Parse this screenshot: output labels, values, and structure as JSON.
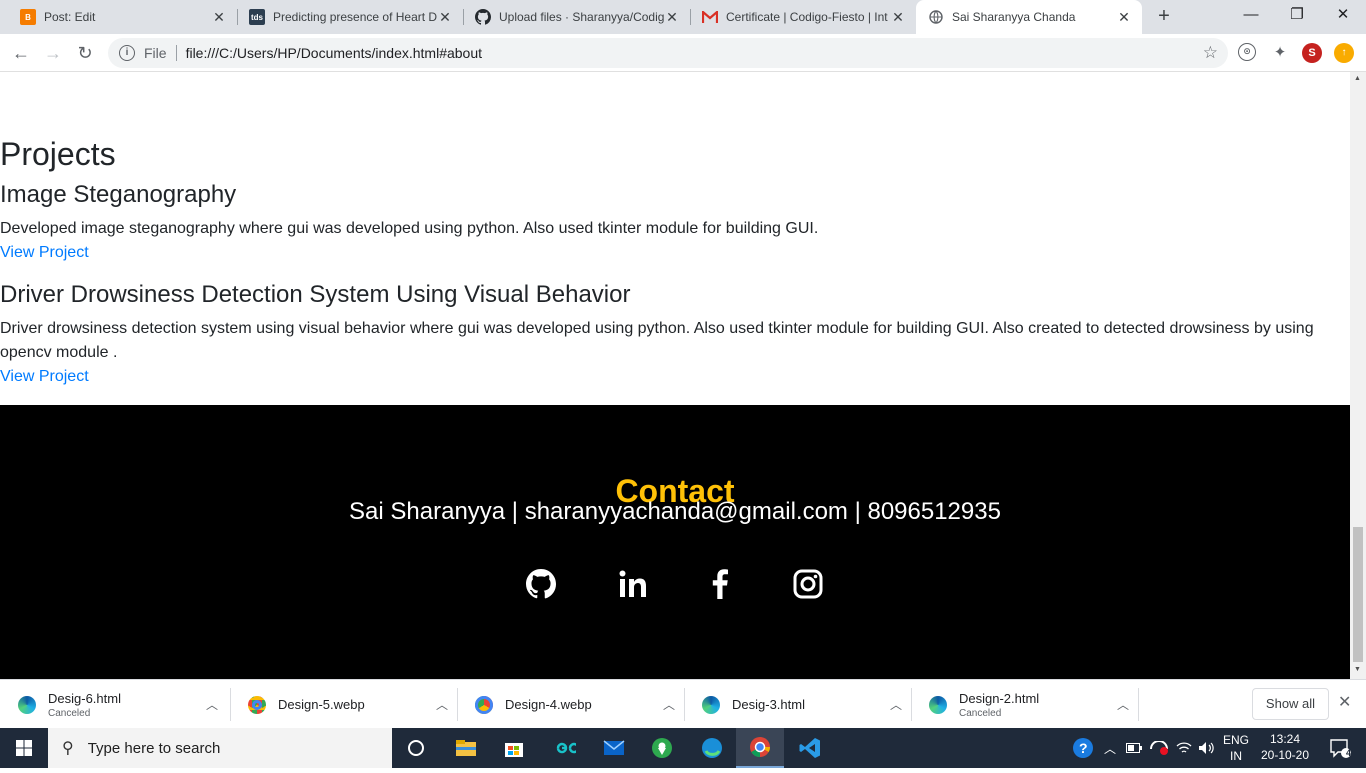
{
  "browser": {
    "tabs": [
      {
        "title": "Post: Edit",
        "favicon": "blogger-icon",
        "color": "#f57c00"
      },
      {
        "title": "Predicting presence of Heart D",
        "favicon": "tds-icon",
        "color": "#2c3e50",
        "favicon_text": "tds"
      },
      {
        "title": "Upload files · Sharanyya/Codig",
        "favicon": "github-icon",
        "color": "#24292e"
      },
      {
        "title": "Certificate | Codigo-Fiesto | Int",
        "favicon": "gmail-icon",
        "color": "#d93025"
      },
      {
        "title": "Sai Sharanyya Chanda",
        "favicon": "globe-icon",
        "color": "#5f6368"
      }
    ],
    "address": {
      "scheme_label": "File",
      "url": "file:///C:/Users/HP/Documents/index.html#about"
    },
    "profile_initial": "S"
  },
  "page": {
    "projects_heading": "Projects",
    "projects": [
      {
        "title": "Image Steganography",
        "description": "Developed image steganography where gui was developed using python. Also used tkinter module for building GUI.",
        "link": "View Project"
      },
      {
        "title": "Driver Drowsiness Detection System Using Visual Behavior",
        "description": "Driver drowsiness detection system using visual behavior where gui was developed using python. Also used tkinter module for building GUI. Also created to detected drowsiness by using opencv module .",
        "link": "View Project"
      }
    ],
    "footer": {
      "heading": "Contact",
      "line": "Sai Sharanyya | sharanyyachanda@gmail.com | 8096512935",
      "social": [
        "github-icon",
        "linkedin-icon",
        "facebook-icon",
        "instagram-icon"
      ],
      "heading_color": "#ffc107"
    }
  },
  "downloads": {
    "items": [
      {
        "name": "Desig-6.html",
        "status": "Canceled",
        "icon": "edge-icon"
      },
      {
        "name": "Design-5.webp",
        "status": "",
        "icon": "chrome-icon"
      },
      {
        "name": "Design-4.webp",
        "status": "",
        "icon": "chrome-icon"
      },
      {
        "name": "Desig-3.html",
        "status": "",
        "icon": "edge-icon"
      },
      {
        "name": "Design-2.html",
        "status": "Canceled",
        "icon": "edge-icon"
      }
    ],
    "show_all": "Show all"
  },
  "taskbar": {
    "search_placeholder": "Type here to search",
    "language_top": "ENG",
    "language_bottom": "IN",
    "time": "13:24",
    "date": "20-10-20",
    "notification_count": "4"
  }
}
